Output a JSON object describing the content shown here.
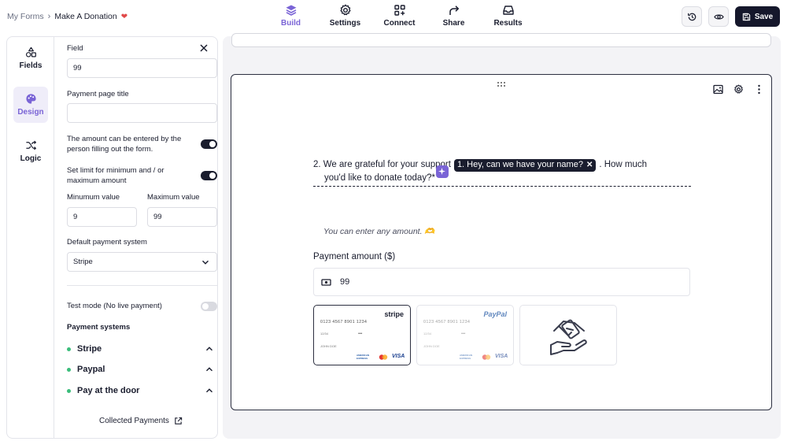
{
  "breadcrumb": {
    "root": "My Forms",
    "current": "Make A Donation"
  },
  "nav": {
    "tabs": [
      {
        "label": "Build",
        "icon": "layers-icon",
        "active": true
      },
      {
        "label": "Settings",
        "icon": "gear-icon"
      },
      {
        "label": "Connect",
        "icon": "connect-icon"
      },
      {
        "label": "Share",
        "icon": "share-icon"
      },
      {
        "label": "Results",
        "icon": "inbox-icon"
      }
    ]
  },
  "actions": {
    "history_icon": "history-icon",
    "preview_icon": "eye-icon",
    "save_label": "Save"
  },
  "sidebar": {
    "items": [
      {
        "label": "Fields",
        "icon": "shapes-icon"
      },
      {
        "label": "Design",
        "icon": "palette-icon",
        "active": true
      },
      {
        "label": "Logic",
        "icon": "shuffle-icon"
      }
    ]
  },
  "settings": {
    "field_label": "Field",
    "field_value": "99",
    "payment_title_label": "Payment page title",
    "payment_title_value": "",
    "amount_entry_text": "The amount can be entered by the person filling out the form.",
    "amount_entry_on": true,
    "limit_text": "Set limit for minimum and / or maximum amount",
    "limit_on": true,
    "min_label": "Minumum value",
    "min_value": "9",
    "max_label": "Maximum value",
    "max_value": "99",
    "default_system_label": "Default payment system",
    "default_system_value": "Stripe",
    "test_mode_label": "Test mode (No live payment)",
    "test_mode_on": false,
    "payment_systems_label": "Payment systems",
    "systems": [
      "Stripe",
      "Paypal",
      "Pay at the door"
    ],
    "collected_label": "Collected Payments"
  },
  "question": {
    "prefix": "2. We are grateful for your support",
    "chip": "1. Hey, can we have your name?",
    "suffix": ". How much",
    "line2": "you'd like to donate today?*",
    "hint": "You can enter any amount. 🫶",
    "amount_label": "Payment amount ($)",
    "amount_value": "99"
  },
  "cards": {
    "number": "0123 4567 8901 1234",
    "holder": "JOHN DOE",
    "stripe_brand": "stripe",
    "paypal_brand": "PayPal",
    "amex": "AMERICAN EXPRESS",
    "visa": "VISA",
    "expiry": "12/34",
    "cvv": "•••"
  },
  "colors": {
    "accent": "#7a64d6",
    "dark": "#15172b",
    "green": "#3bbd7b"
  }
}
